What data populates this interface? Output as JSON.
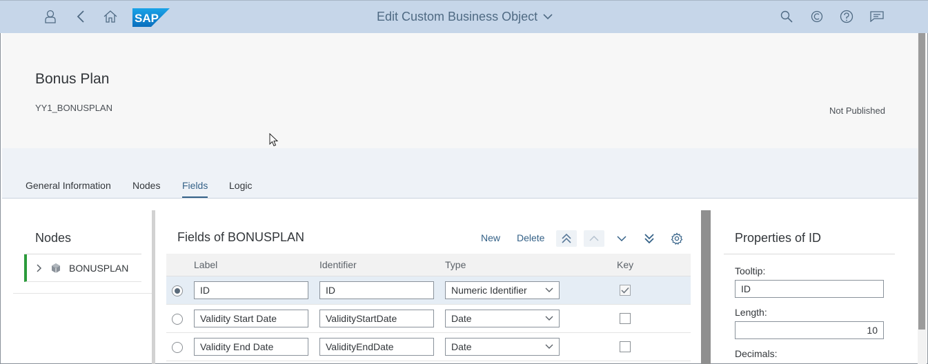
{
  "shell": {
    "title": "Edit Custom Business Object",
    "logo_text": "SAP",
    "icons": [
      "user-icon",
      "back-icon",
      "home-icon",
      "search-icon",
      "copilot-icon",
      "help-icon",
      "notifications-icon"
    ]
  },
  "header": {
    "title": "Bonus Plan",
    "identifier": "YY1_BONUSPLAN",
    "status": "Not Published"
  },
  "tabs": [
    {
      "label": "General Information",
      "active": false
    },
    {
      "label": "Nodes",
      "active": false
    },
    {
      "label": "Fields",
      "active": true
    },
    {
      "label": "Logic",
      "active": false
    }
  ],
  "nodes_panel": {
    "title": "Nodes",
    "items": [
      {
        "label": "BONUSPLAN",
        "selected": true
      }
    ]
  },
  "fields_panel": {
    "title": "Fields of BONUSPLAN",
    "toolbar": {
      "new_label": "New",
      "delete_label": "Delete"
    },
    "columns": {
      "label": "Label",
      "identifier": "Identifier",
      "type": "Type",
      "key": "Key"
    },
    "rows": [
      {
        "selected": true,
        "label": "ID",
        "identifier": "ID",
        "type": "Numeric Identifier",
        "key": true
      },
      {
        "selected": false,
        "label": "Validity Start Date",
        "identifier": "ValidityStartDate",
        "type": "Date",
        "key": false
      },
      {
        "selected": false,
        "label": "Validity End Date",
        "identifier": "ValidityEndDate",
        "type": "Date",
        "key": false
      }
    ]
  },
  "properties_panel": {
    "title": "Properties of ID",
    "tooltip_label": "Tooltip:",
    "tooltip_value": "ID",
    "length_label": "Length:",
    "length_value": "10",
    "decimals_label": "Decimals:"
  },
  "colors": {
    "shell_bg": "#c6d6e9",
    "accent": "#346187",
    "node_indicator": "#2b9b3b"
  }
}
